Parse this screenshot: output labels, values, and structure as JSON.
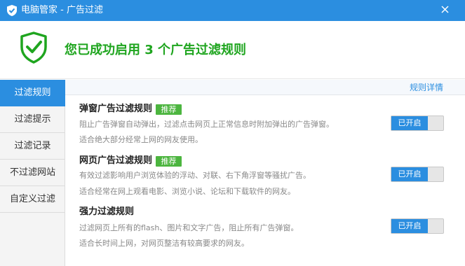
{
  "window": {
    "title": "电脑管家 - 广告过滤"
  },
  "banner": {
    "headline": "您已成功启用 3 个广告过滤规则"
  },
  "sidebar": {
    "items": [
      {
        "label": "过滤规则",
        "active": true
      },
      {
        "label": "过滤提示",
        "active": false
      },
      {
        "label": "过滤记录",
        "active": false
      },
      {
        "label": "不过滤网站",
        "active": false
      },
      {
        "label": "自定义过滤",
        "active": false
      }
    ]
  },
  "content": {
    "detail_link": "规则详情",
    "rules": [
      {
        "title": "弹窗广告过滤规则",
        "badge": "推荐",
        "desc1": "阻止广告弹窗自动弹出，过滤点击网页上正常信息时附加弹出的广告弹窗。",
        "desc2": "适合绝大部分经常上网的网友使用。",
        "toggle_label": "已开启"
      },
      {
        "title": "网页广告过滤规则",
        "badge": "推荐",
        "desc1": "有效过滤影响用户浏览体验的浮动、对联、右下角浮窗等骚扰广告。",
        "desc2": "适合经常在网上观看电影、浏览小说、论坛和下载软件的网友。",
        "toggle_label": "已开启"
      },
      {
        "title": "强力过滤规则",
        "badge": "",
        "desc1": "过滤网页上所有的flash、图片和文字广告，阻止所有广告弹窗。",
        "desc2": "适合长时间上网，对网页整洁有较高要求的网友。",
        "toggle_label": "已开启"
      }
    ]
  },
  "colors": {
    "accent": "#2b8ee0",
    "success": "#1fa51f",
    "badge": "#4cb53f"
  }
}
